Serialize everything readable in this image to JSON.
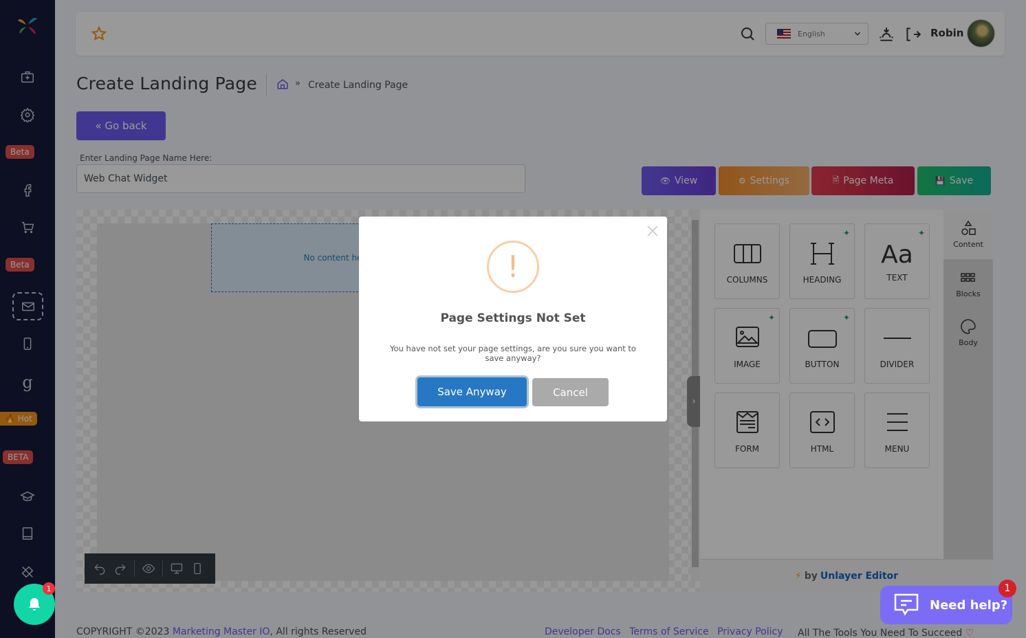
{
  "sidebar": {
    "badges": {
      "beta1": "Beta",
      "beta2": "Beta",
      "hot": "Hot",
      "beta3": "BETA"
    },
    "badge_colors": {
      "beta": "#e2514c",
      "hot": "#f7941d"
    }
  },
  "header": {
    "language": "English",
    "username": "Robin"
  },
  "page": {
    "title": "Create Landing Page",
    "breadcrumb_sep": "»",
    "breadcrumb_current": "Create Landing Page",
    "go_back": "Go back",
    "name_label": "Enter Landing Page Name Here:",
    "name_value": "Web Chat Widget"
  },
  "actions": {
    "view": "View",
    "settings": "Settings",
    "page_meta": "Page Meta",
    "save": "Save"
  },
  "editor": {
    "empty_text": "No content here. Drag content from right.",
    "tiles": [
      "COLUMNS",
      "HEADING",
      "TEXT",
      "IMAGE",
      "BUTTON",
      "DIVIDER",
      "FORM",
      "HTML",
      "MENU"
    ],
    "tabs": [
      "Content",
      "Blocks",
      "Body"
    ],
    "powered_by": "by",
    "powered_brand": "Unlayer Editor",
    "collapse": "›"
  },
  "modal": {
    "icon": "!",
    "title": "Page Settings Not Set",
    "text": "You have not set your page settings, are you sure you want to save anyway?",
    "confirm": "Save Anyway",
    "cancel": "Cancel"
  },
  "footer": {
    "copyright_prefix": "COPYRIGHT ©2023",
    "company": "Marketing Master IO",
    "copyright_suffix": ", All rights Reserved",
    "links": [
      "Developer Docs",
      "Terms of Service",
      "Privacy Policy"
    ],
    "tagline": "All The Tools You Need To Succeed"
  },
  "notifications": {
    "count": "1"
  },
  "help": {
    "label": "Need help?",
    "count": "1"
  }
}
